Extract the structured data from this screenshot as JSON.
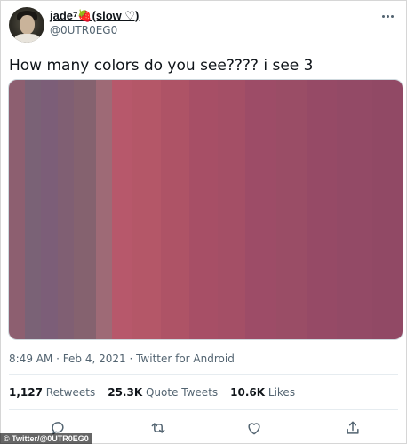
{
  "tweet": {
    "author": {
      "display_name": "jade⁷🍓(slow ♡)",
      "handle": "@0UTR0EG0"
    },
    "text": "How many colors do you see???? i see 3",
    "media": {
      "strips": [
        {
          "color": "#8d5f70"
        },
        {
          "color": "#7a6276"
        },
        {
          "color": "#7c5e78"
        },
        {
          "color": "#805f73"
        },
        {
          "color": "#85626f"
        },
        {
          "color": "#9e6a76"
        },
        {
          "color": "#b7586b"
        },
        {
          "color": "#b45768"
        },
        {
          "color": "#ae5366"
        },
        {
          "color": "#a74f66"
        },
        {
          "color": "#a44f66"
        },
        {
          "color": "#9d4c67"
        },
        {
          "color": "#9a4d66"
        },
        {
          "color": "#964a66"
        },
        {
          "color": "#934a66"
        },
        {
          "color": "#914965"
        }
      ]
    },
    "meta": "8:49 AM · Feb 4, 2021 · Twitter for Android",
    "stats": {
      "retweets_count": "1,127",
      "retweets_label": "Retweets",
      "quotes_count": "25.3K",
      "quotes_label": "Quote Tweets",
      "likes_count": "10.6K",
      "likes_label": "Likes"
    },
    "actions": [
      {
        "icon": "reply-icon"
      },
      {
        "icon": "retweet-icon"
      },
      {
        "icon": "like-icon"
      },
      {
        "icon": "share-icon"
      }
    ]
  },
  "credit": "© Twitter/@0UTR0EG0"
}
